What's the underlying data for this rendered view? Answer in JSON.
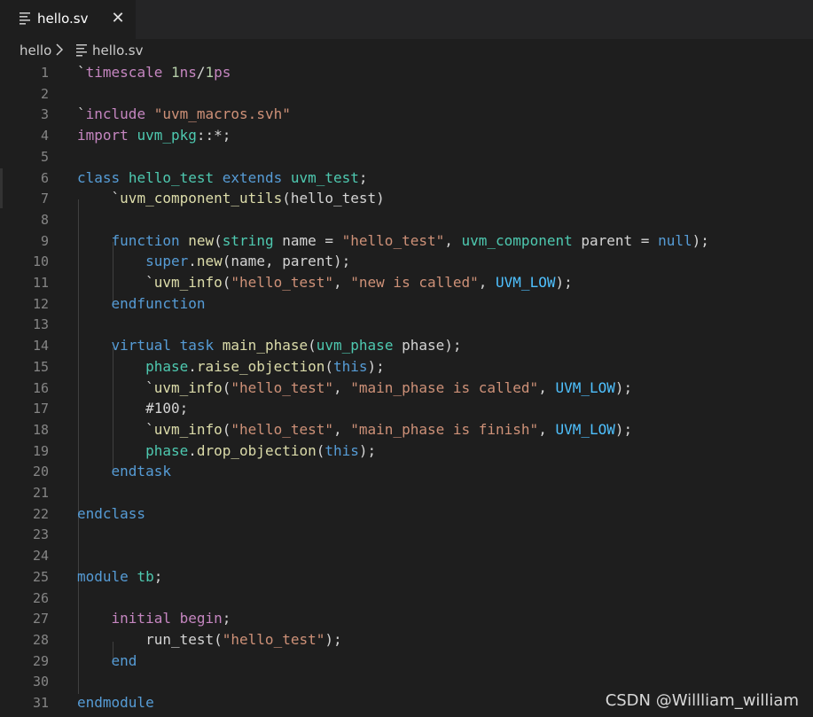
{
  "tab": {
    "label": "hello.sv",
    "close": "✕"
  },
  "breadcrumb": {
    "folder": "hello",
    "file": "hello.sv"
  },
  "code": {
    "lines": [
      [
        [
          "pl",
          "`"
        ],
        [
          "pp",
          "timescale"
        ],
        [
          "pl",
          " "
        ],
        [
          "nm",
          "1"
        ],
        [
          "pp",
          "ns"
        ],
        [
          "pl",
          "/"
        ],
        [
          "nm",
          "1"
        ],
        [
          "pp",
          "ps"
        ]
      ],
      [],
      [
        [
          "pl",
          "`"
        ],
        [
          "pp",
          "include"
        ],
        [
          "pl",
          " "
        ],
        [
          "st",
          "\"uvm_macros.svh\""
        ]
      ],
      [
        [
          "pp",
          "import"
        ],
        [
          "pl",
          " "
        ],
        [
          "ty",
          "uvm_pkg"
        ],
        [
          "pl",
          "::*;"
        ]
      ],
      [],
      [
        [
          "kw",
          "class"
        ],
        [
          "pl",
          " "
        ],
        [
          "ty",
          "hello_test"
        ],
        [
          "pl",
          " "
        ],
        [
          "kw",
          "extends"
        ],
        [
          "pl",
          " "
        ],
        [
          "ty",
          "uvm_test"
        ],
        [
          "pl",
          ";"
        ]
      ],
      [
        [
          "pl",
          "    `"
        ],
        [
          "fn",
          "uvm_component_utils"
        ],
        [
          "pl",
          "(hello_test)"
        ]
      ],
      [],
      [
        [
          "pl",
          "    "
        ],
        [
          "kw",
          "function"
        ],
        [
          "pl",
          " "
        ],
        [
          "fn",
          "new"
        ],
        [
          "pl",
          "("
        ],
        [
          "ty",
          "string"
        ],
        [
          "pl",
          " name = "
        ],
        [
          "st",
          "\"hello_test\""
        ],
        [
          "pl",
          ", "
        ],
        [
          "ty",
          "uvm_component"
        ],
        [
          "pl",
          " parent = "
        ],
        [
          "kw",
          "null"
        ],
        [
          "pl",
          ");"
        ]
      ],
      [
        [
          "pl",
          "        "
        ],
        [
          "kw",
          "super"
        ],
        [
          "pl",
          "."
        ],
        [
          "fn",
          "new"
        ],
        [
          "pl",
          "(name, parent);"
        ]
      ],
      [
        [
          "pl",
          "        `"
        ],
        [
          "fn",
          "uvm_info"
        ],
        [
          "pl",
          "("
        ],
        [
          "st",
          "\"hello_test\""
        ],
        [
          "pl",
          ", "
        ],
        [
          "st",
          "\"new is called\""
        ],
        [
          "pl",
          ", "
        ],
        [
          "ct",
          "UVM_LOW"
        ],
        [
          "pl",
          ");"
        ]
      ],
      [
        [
          "pl",
          "    "
        ],
        [
          "kw",
          "endfunction"
        ]
      ],
      [],
      [
        [
          "pl",
          "    "
        ],
        [
          "kw",
          "virtual"
        ],
        [
          "pl",
          " "
        ],
        [
          "kw",
          "task"
        ],
        [
          "pl",
          " "
        ],
        [
          "fn",
          "main_phase"
        ],
        [
          "pl",
          "("
        ],
        [
          "ty",
          "uvm_phase"
        ],
        [
          "pl",
          " phase);"
        ]
      ],
      [
        [
          "pl",
          "        "
        ],
        [
          "ty",
          "phase"
        ],
        [
          "pl",
          "."
        ],
        [
          "fn",
          "raise_objection"
        ],
        [
          "pl",
          "("
        ],
        [
          "kw",
          "this"
        ],
        [
          "pl",
          ");"
        ]
      ],
      [
        [
          "pl",
          "        `"
        ],
        [
          "fn",
          "uvm_info"
        ],
        [
          "pl",
          "("
        ],
        [
          "st",
          "\"hello_test\""
        ],
        [
          "pl",
          ", "
        ],
        [
          "st",
          "\"main_phase is called\""
        ],
        [
          "pl",
          ", "
        ],
        [
          "ct",
          "UVM_LOW"
        ],
        [
          "pl",
          ");"
        ]
      ],
      [
        [
          "pl",
          "        #100;"
        ]
      ],
      [
        [
          "pl",
          "        `"
        ],
        [
          "fn",
          "uvm_info"
        ],
        [
          "pl",
          "("
        ],
        [
          "st",
          "\"hello_test\""
        ],
        [
          "pl",
          ", "
        ],
        [
          "st",
          "\"main_phase is finish\""
        ],
        [
          "pl",
          ", "
        ],
        [
          "ct",
          "UVM_LOW"
        ],
        [
          "pl",
          ");"
        ]
      ],
      [
        [
          "pl",
          "        "
        ],
        [
          "ty",
          "phase"
        ],
        [
          "pl",
          "."
        ],
        [
          "fn",
          "drop_objection"
        ],
        [
          "pl",
          "("
        ],
        [
          "kw",
          "this"
        ],
        [
          "pl",
          ");"
        ]
      ],
      [
        [
          "pl",
          "    "
        ],
        [
          "kw",
          "endtask"
        ]
      ],
      [],
      [
        [
          "kw",
          "endclass"
        ]
      ],
      [],
      [],
      [
        [
          "kw",
          "module"
        ],
        [
          "pl",
          " "
        ],
        [
          "ty",
          "tb"
        ],
        [
          "pl",
          ";"
        ]
      ],
      [],
      [
        [
          "pl",
          "    "
        ],
        [
          "pp",
          "initial"
        ],
        [
          "pl",
          " "
        ],
        [
          "pp",
          "begin"
        ],
        [
          "pl",
          ";"
        ]
      ],
      [
        [
          "pl",
          "        run_test("
        ],
        [
          "st",
          "\"hello_test\""
        ],
        [
          "pl",
          ");"
        ]
      ],
      [
        [
          "pl",
          "    "
        ],
        [
          "kw",
          "end"
        ]
      ],
      [],
      [
        [
          "kw",
          "endmodule"
        ]
      ]
    ]
  },
  "watermark": "CSDN @Willliam_william",
  "colors": {
    "background": "#1e1e1e",
    "keyword": "#569cd6",
    "type": "#4ec9b0",
    "function": "#dcdcaa",
    "string": "#ce9178",
    "number": "#b5cea8",
    "directive": "#c586c0",
    "constant": "#4fc1ff",
    "line_number": "#858585"
  }
}
